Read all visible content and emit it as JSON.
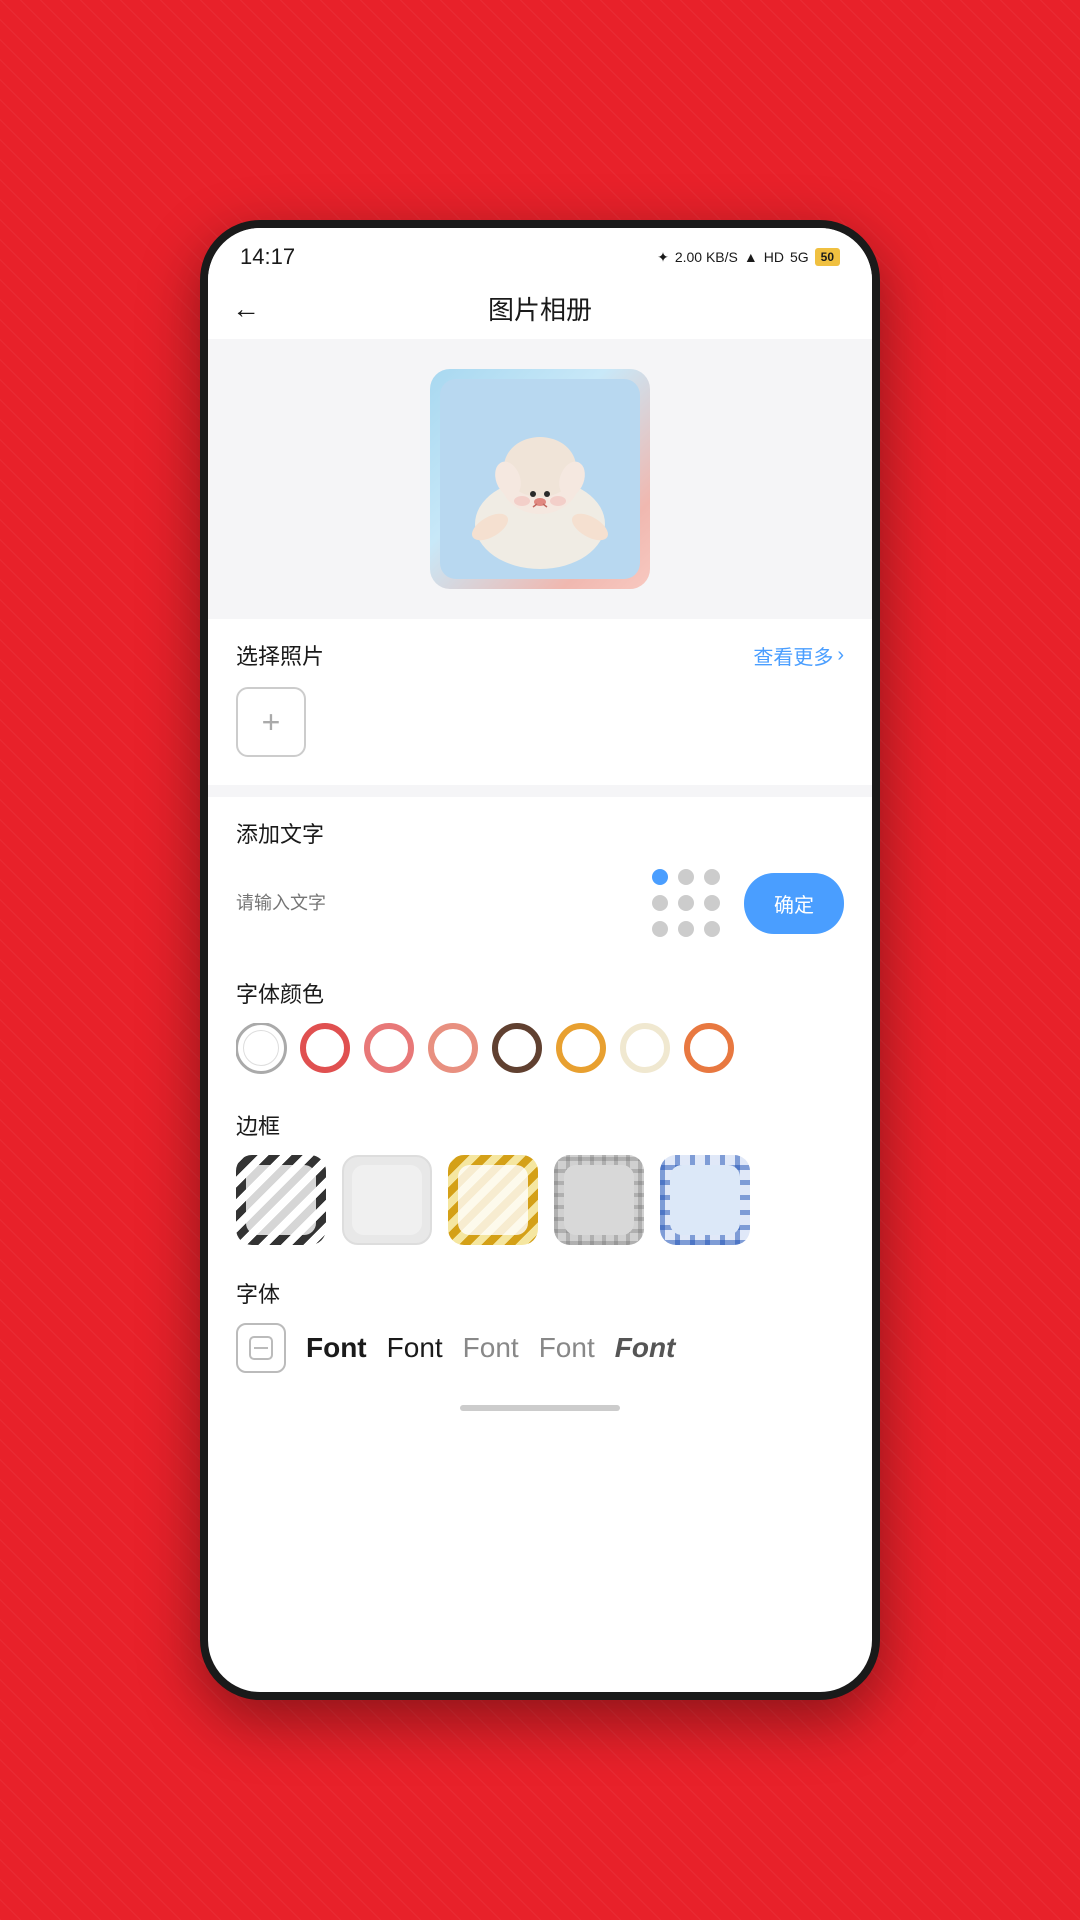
{
  "statusBar": {
    "time": "14:17",
    "bluetooth": "✦",
    "speed": "2.00 KB/S",
    "wifi": "WiFi",
    "hd": "HD",
    "signal5g": "5G",
    "battery": "50"
  },
  "header": {
    "backLabel": "←",
    "title": "图片相册"
  },
  "photoSection": {
    "title": "选择照片",
    "seeMore": "查看更多",
    "addIcon": "+"
  },
  "textSection": {
    "title": "添加文字",
    "inputPlaceholder": "请输入文字",
    "confirmLabel": "确定",
    "dots": [
      {
        "active": true
      },
      {
        "active": false
      },
      {
        "active": false
      },
      {
        "active": false
      },
      {
        "active": false
      },
      {
        "active": false
      },
      {
        "active": false
      },
      {
        "active": false
      },
      {
        "active": false
      }
    ]
  },
  "colorSection": {
    "title": "字体颜色",
    "colors": [
      {
        "color": "transparent",
        "border": "#aaa",
        "selected": true
      },
      {
        "color": "#e05050",
        "border": "transparent",
        "selected": false
      },
      {
        "color": "#e87070",
        "border": "transparent",
        "selected": false
      },
      {
        "color": "#e88070",
        "border": "transparent",
        "selected": false
      },
      {
        "color": "#603828",
        "border": "transparent",
        "selected": false
      },
      {
        "color": "#e8a030",
        "border": "transparent",
        "selected": false
      },
      {
        "color": "#f0e8d0",
        "border": "transparent",
        "selected": false
      },
      {
        "color": "#e87840",
        "border": "transparent",
        "selected": false
      }
    ]
  },
  "borderSection": {
    "title": "边框",
    "borders": [
      {
        "type": "black-stripe",
        "label": "black stripe"
      },
      {
        "type": "white-plain",
        "label": "white plain"
      },
      {
        "type": "gold-stripe",
        "label": "gold stripe"
      },
      {
        "type": "plaid",
        "label": "plaid"
      },
      {
        "type": "blue-check",
        "label": "blue check"
      }
    ]
  },
  "fontSection": {
    "title": "字体",
    "fonts": [
      {
        "type": "none",
        "label": "—"
      },
      {
        "type": "bold",
        "label": "Font"
      },
      {
        "type": "medium",
        "label": "Font"
      },
      {
        "type": "light",
        "label": "Font"
      },
      {
        "type": "thin",
        "label": "Font"
      },
      {
        "type": "italic",
        "label": "Font"
      }
    ]
  }
}
